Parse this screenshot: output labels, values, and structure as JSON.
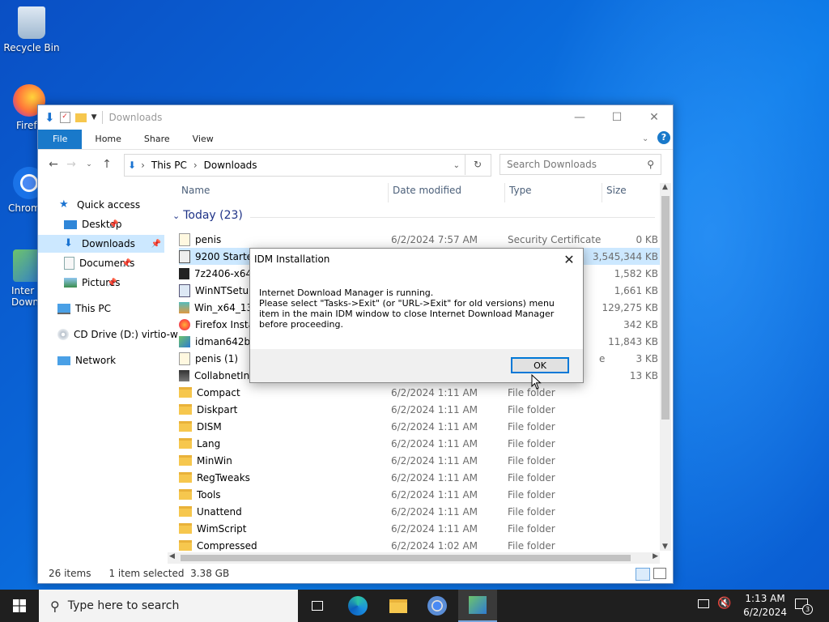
{
  "desktop": {
    "icons": [
      {
        "label": "Recycle Bin"
      },
      {
        "label": "Firef"
      },
      {
        "label": "Chrom"
      },
      {
        "label": "Inter Down"
      }
    ]
  },
  "explorer": {
    "title": "Downloads",
    "ribbon_tabs": [
      "File",
      "Home",
      "Share",
      "View"
    ],
    "breadcrumb": [
      "This PC",
      "Downloads"
    ],
    "search_placeholder": "Search Downloads",
    "nav": [
      {
        "label": "Quick access"
      },
      {
        "label": "Desktop"
      },
      {
        "label": "Downloads"
      },
      {
        "label": "Documents"
      },
      {
        "label": "Pictures"
      },
      {
        "label": "This PC"
      },
      {
        "label": "CD Drive (D:) virtio-w"
      },
      {
        "label": "Network"
      }
    ],
    "columns": [
      "Name",
      "Date modified",
      "Type",
      "Size"
    ],
    "group_label": "Today (23)",
    "files": [
      {
        "name": "penis",
        "date": "6/2/2024 7:57 AM",
        "type": "Security Certificate",
        "size": "0 KB"
      },
      {
        "name": "9200 Starter",
        "date": "",
        "type": "",
        "size": "3,545,344 KB"
      },
      {
        "name": "7z2406-x64",
        "date": "",
        "type": "",
        "size": "1,582 KB"
      },
      {
        "name": "WinNTSetup",
        "date": "",
        "type": "",
        "size": "1,661 KB"
      },
      {
        "name": "Win_x64_130",
        "date": "",
        "type": "",
        "size": "129,275 KB"
      },
      {
        "name": "Firefox Insta",
        "date": "",
        "type": "",
        "size": "342 KB"
      },
      {
        "name": "idman642bu",
        "date": "",
        "type": "",
        "size": "11,843 KB"
      },
      {
        "name": "penis (1)",
        "date": "",
        "type": "e",
        "size": "3 KB"
      },
      {
        "name": "CollabnetIns",
        "date": "",
        "type": "",
        "size": "13 KB"
      },
      {
        "name": "Compact",
        "date": "6/2/2024 1:11 AM",
        "type": "File folder",
        "size": ""
      },
      {
        "name": "Diskpart",
        "date": "6/2/2024 1:11 AM",
        "type": "File folder",
        "size": ""
      },
      {
        "name": "DISM",
        "date": "6/2/2024 1:11 AM",
        "type": "File folder",
        "size": ""
      },
      {
        "name": "Lang",
        "date": "6/2/2024 1:11 AM",
        "type": "File folder",
        "size": ""
      },
      {
        "name": "MinWin",
        "date": "6/2/2024 1:11 AM",
        "type": "File folder",
        "size": ""
      },
      {
        "name": "RegTweaks",
        "date": "6/2/2024 1:11 AM",
        "type": "File folder",
        "size": ""
      },
      {
        "name": "Tools",
        "date": "6/2/2024 1:11 AM",
        "type": "File folder",
        "size": ""
      },
      {
        "name": "Unattend",
        "date": "6/2/2024 1:11 AM",
        "type": "File folder",
        "size": ""
      },
      {
        "name": "WimScript",
        "date": "6/2/2024 1:11 AM",
        "type": "File folder",
        "size": ""
      },
      {
        "name": "Compressed",
        "date": "6/2/2024 1:02 AM",
        "type": "File folder",
        "size": ""
      }
    ],
    "status": {
      "items": "26 items",
      "selected": "1 item selected  3.38 GB"
    }
  },
  "dialog": {
    "title": "IDM Installation",
    "line1": "Internet Download Manager is running.",
    "line2": "Please select \"Tasks->Exit\" (or \"URL->Exit\" for old versions) menu item in the main IDM window to close Internet Download Manager before proceeding.",
    "ok_label": "OK"
  },
  "taskbar": {
    "search_placeholder": "Type here to search",
    "time": "1:13 AM",
    "date": "6/2/2024",
    "notifications": "3"
  },
  "colors": {
    "accent": "#0078d7",
    "file_tab": "#1979ca",
    "selection": "#cce8ff"
  }
}
